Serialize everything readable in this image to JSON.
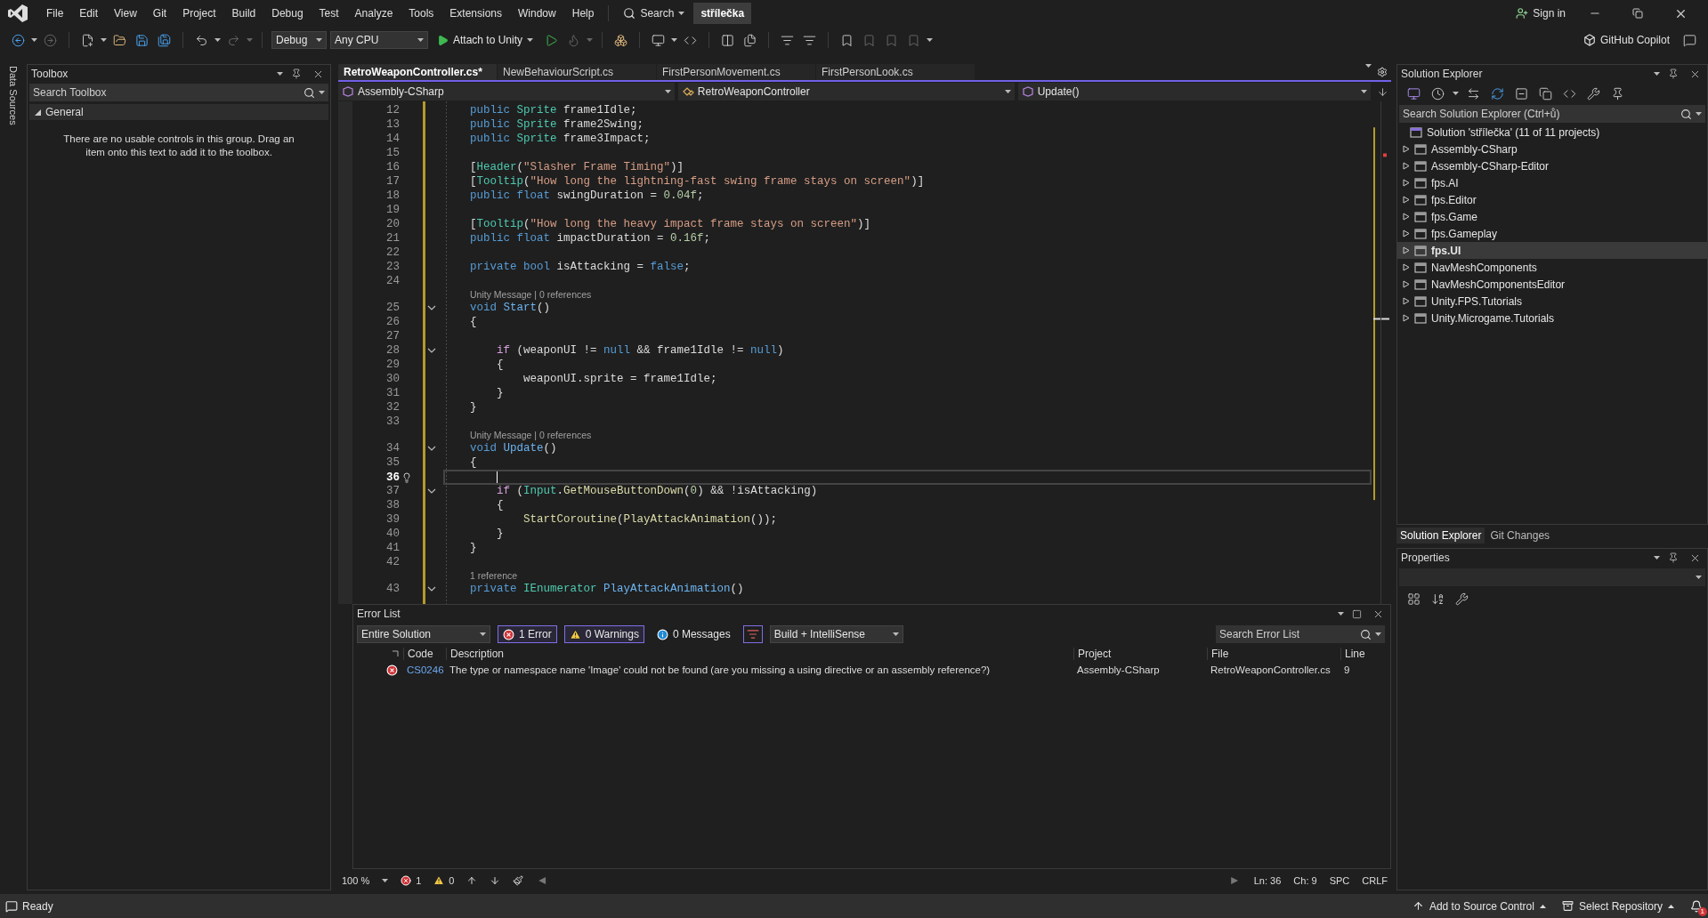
{
  "menu": {
    "items": [
      "File",
      "Edit",
      "View",
      "Git",
      "Project",
      "Build",
      "Debug",
      "Test",
      "Analyze",
      "Tools",
      "Extensions",
      "Window",
      "Help"
    ],
    "search": "Search",
    "solution": "střílečka",
    "sign_in": "Sign in"
  },
  "toolbar": {
    "configuration": "Debug",
    "platform": "Any CPU",
    "run": "Attach to Unity",
    "copilot": "GitHub Copilot"
  },
  "side_strip": {
    "label": "Data Sources"
  },
  "toolbox": {
    "title": "Toolbox",
    "search": {
      "placeholder": "Search Toolbox"
    },
    "group": {
      "label": "General",
      "expanded": true,
      "message": "There are no usable controls in this group. Drag an item onto this text to add it to the toolbox."
    }
  },
  "editor": {
    "tabs": [
      {
        "label": "RetroWeaponController.cs*",
        "selected": true
      },
      {
        "label": "NewBehaviourScript.cs",
        "selected": false
      },
      {
        "label": "FirstPersonMovement.cs",
        "selected": false
      },
      {
        "label": "FirstPersonLook.cs",
        "selected": false
      }
    ],
    "nav": [
      {
        "kind": "project",
        "label": "Assembly-CSharp"
      },
      {
        "kind": "class",
        "label": "RetroWeaponController"
      },
      {
        "kind": "method",
        "label": "Update()"
      }
    ],
    "lines": [
      {
        "kind": "code",
        "n": "12",
        "fold": false,
        "current": false,
        "tokens": [
          {
            "kind": "kw",
            "t": "public "
          },
          {
            "kind": "type",
            "t": "Sprite"
          },
          {
            "kind": "plain",
            "t": " frame1Idle;"
          }
        ]
      },
      {
        "kind": "code",
        "n": "13",
        "fold": false,
        "current": false,
        "tokens": [
          {
            "kind": "kw",
            "t": "public "
          },
          {
            "kind": "type",
            "t": "Sprite"
          },
          {
            "kind": "plain",
            "t": " frame2Swing;"
          }
        ]
      },
      {
        "kind": "code",
        "n": "14",
        "fold": false,
        "current": false,
        "tokens": [
          {
            "kind": "kw",
            "t": "public "
          },
          {
            "kind": "type",
            "t": "Sprite"
          },
          {
            "kind": "plain",
            "t": " frame3Impact;"
          }
        ]
      },
      {
        "kind": "code",
        "n": "15",
        "fold": false,
        "current": false
      },
      {
        "kind": "code",
        "n": "16",
        "fold": false,
        "current": false,
        "tokens": [
          {
            "kind": "plain",
            "t": "["
          },
          {
            "kind": "type",
            "t": "Header"
          },
          {
            "kind": "plain",
            "t": "("
          },
          {
            "kind": "str",
            "t": "\"Slasher Frame Timing\""
          },
          {
            "kind": "plain",
            "t": ")]"
          }
        ]
      },
      {
        "kind": "code",
        "n": "17",
        "fold": false,
        "current": false,
        "tokens": [
          {
            "kind": "plain",
            "t": "["
          },
          {
            "kind": "type",
            "t": "Tooltip"
          },
          {
            "kind": "plain",
            "t": "("
          },
          {
            "kind": "str",
            "t": "\"How long the lightning-fast swing frame stays on screen\""
          },
          {
            "kind": "plain",
            "t": ")]"
          }
        ]
      },
      {
        "kind": "code",
        "n": "18",
        "fold": false,
        "current": false,
        "tokens": [
          {
            "kind": "kw",
            "t": "public float"
          },
          {
            "kind": "plain",
            "t": " swingDuration = "
          },
          {
            "kind": "num",
            "t": "0.04f"
          },
          {
            "kind": "plain",
            "t": ";"
          }
        ]
      },
      {
        "kind": "code",
        "n": "19",
        "fold": false,
        "current": false
      },
      {
        "kind": "code",
        "n": "20",
        "fold": false,
        "current": false,
        "tokens": [
          {
            "kind": "plain",
            "t": "["
          },
          {
            "kind": "type",
            "t": "Tooltip"
          },
          {
            "kind": "plain",
            "t": "("
          },
          {
            "kind": "str",
            "t": "\"How long the heavy impact frame stays on screen\""
          },
          {
            "kind": "plain",
            "t": ")]"
          }
        ]
      },
      {
        "kind": "code",
        "n": "21",
        "fold": false,
        "current": false,
        "tokens": [
          {
            "kind": "kw",
            "t": "public float"
          },
          {
            "kind": "plain",
            "t": " impactDuration = "
          },
          {
            "kind": "num",
            "t": "0.16f"
          },
          {
            "kind": "plain",
            "t": ";"
          }
        ]
      },
      {
        "kind": "code",
        "n": "22",
        "fold": false,
        "current": false
      },
      {
        "kind": "code",
        "n": "23",
        "fold": false,
        "current": false,
        "tokens": [
          {
            "kind": "kw",
            "t": "private bool"
          },
          {
            "kind": "plain",
            "t": " isAttacking = "
          },
          {
            "kind": "kw",
            "t": "false"
          },
          {
            "kind": "plain",
            "t": ";"
          }
        ]
      },
      {
        "kind": "code",
        "n": "24",
        "fold": false,
        "current": false
      },
      {
        "kind": "lens",
        "text": "Unity Message | 0 references"
      },
      {
        "kind": "code",
        "n": "25",
        "fold": true,
        "current": false,
        "tokens": [
          {
            "kind": "kw",
            "t": "void "
          },
          {
            "kind": "fn",
            "t": "Start"
          },
          {
            "kind": "plain",
            "t": "()"
          }
        ]
      },
      {
        "kind": "code",
        "n": "26",
        "fold": false,
        "current": false,
        "tokens": [
          {
            "kind": "plain",
            "t": "{"
          }
        ]
      },
      {
        "kind": "code",
        "n": "27",
        "fold": false,
        "current": false
      },
      {
        "kind": "code",
        "n": "28",
        "fold": true,
        "current": false,
        "tokens": [
          {
            "kind": "ctrl",
            "t": "    if"
          },
          {
            "kind": "plain",
            "t": " (weaponUI != "
          },
          {
            "kind": "kw",
            "t": "null"
          },
          {
            "kind": "plain",
            "t": " && frame1Idle != "
          },
          {
            "kind": "kw",
            "t": "null"
          },
          {
            "kind": "plain",
            "t": ")"
          }
        ]
      },
      {
        "kind": "code",
        "n": "29",
        "fold": false,
        "current": false,
        "tokens": [
          {
            "kind": "plain",
            "t": "    {"
          }
        ]
      },
      {
        "kind": "code",
        "n": "30",
        "fold": false,
        "current": false,
        "tokens": [
          {
            "kind": "plain",
            "t": "        weaponUI.sprite = frame1Idle;"
          }
        ]
      },
      {
        "kind": "code",
        "n": "31",
        "fold": false,
        "current": false,
        "tokens": [
          {
            "kind": "plain",
            "t": "    }"
          }
        ]
      },
      {
        "kind": "code",
        "n": "32",
        "fold": false,
        "current": false,
        "tokens": [
          {
            "kind": "plain",
            "t": "}"
          }
        ]
      },
      {
        "kind": "code",
        "n": "33",
        "fold": false,
        "current": false
      },
      {
        "kind": "lens",
        "text": "Unity Message | 0 references"
      },
      {
        "kind": "code",
        "n": "34",
        "fold": true,
        "current": false,
        "tokens": [
          {
            "kind": "kw",
            "t": "void "
          },
          {
            "kind": "fn",
            "t": "Update"
          },
          {
            "kind": "plain",
            "t": "()"
          }
        ]
      },
      {
        "kind": "code",
        "n": "35",
        "fold": false,
        "current": false,
        "tokens": [
          {
            "kind": "plain",
            "t": "{"
          }
        ]
      },
      {
        "kind": "code",
        "n": "36",
        "fold": false,
        "current": true
      },
      {
        "kind": "code",
        "n": "37",
        "fold": true,
        "current": false,
        "tokens": [
          {
            "kind": "ctrl",
            "t": "    if"
          },
          {
            "kind": "plain",
            "t": " ("
          },
          {
            "kind": "type",
            "t": "Input"
          },
          {
            "kind": "plain",
            "t": "."
          },
          {
            "kind": "method",
            "t": "GetMouseButtonDown"
          },
          {
            "kind": "plain",
            "t": "("
          },
          {
            "kind": "num",
            "t": "0"
          },
          {
            "kind": "plain",
            "t": ") && !isAttacking)"
          }
        ]
      },
      {
        "kind": "code",
        "n": "38",
        "fold": false,
        "current": false,
        "tokens": [
          {
            "kind": "plain",
            "t": "    {"
          }
        ]
      },
      {
        "kind": "code",
        "n": "39",
        "fold": false,
        "current": false,
        "tokens": [
          {
            "kind": "method",
            "t": "        StartCoroutine"
          },
          {
            "kind": "plain",
            "t": "("
          },
          {
            "kind": "method",
            "t": "PlayAttackAnimation"
          },
          {
            "kind": "plain",
            "t": "());"
          }
        ]
      },
      {
        "kind": "code",
        "n": "40",
        "fold": false,
        "current": false,
        "tokens": [
          {
            "kind": "plain",
            "t": "    }"
          }
        ]
      },
      {
        "kind": "code",
        "n": "41",
        "fold": false,
        "current": false,
        "tokens": [
          {
            "kind": "plain",
            "t": "}"
          }
        ]
      },
      {
        "kind": "code",
        "n": "42",
        "fold": false,
        "current": false
      },
      {
        "kind": "lens",
        "text": "1 reference"
      },
      {
        "kind": "code",
        "n": "43",
        "fold": true,
        "current": false,
        "tokens": [
          {
            "kind": "kw",
            "t": "private "
          },
          {
            "kind": "type",
            "t": "IEnumerator"
          },
          {
            "kind": "fn",
            "t": " PlayAttackAnimation"
          },
          {
            "kind": "plain",
            "t": "()"
          }
        ]
      }
    ]
  },
  "error_list": {
    "title": "Error List",
    "scope": "Entire Solution",
    "toggles": [
      {
        "kind": "error",
        "label": "1 Error",
        "on": true
      },
      {
        "kind": "warning",
        "label": "0 Warnings",
        "on": true
      },
      {
        "kind": "info",
        "label": "0 Messages",
        "on": false
      }
    ],
    "filter_button": {
      "on": true
    },
    "source": "Build + IntelliSense",
    "search": {
      "placeholder": "Search Error List"
    },
    "columns": [
      "Code",
      "Description",
      "Project",
      "File",
      "Line"
    ],
    "rows": [
      {
        "kind": "error",
        "code": "CS0246",
        "description": "The type or namespace name 'Image' could not be found (are you missing a using directive or an assembly reference?)",
        "project": "Assembly-CSharp",
        "file": "RetroWeaponController.cs",
        "line": "9"
      }
    ]
  },
  "status_row": {
    "zoom": "100 %",
    "errors": "1",
    "warnings": "0",
    "line": "Ln: 36",
    "column": "Ch: 9",
    "whitespace": "SPC",
    "line_endings": "CRLF"
  },
  "solution_explorer": {
    "title": "Solution Explorer",
    "search": {
      "placeholder": "Search Solution Explorer (Ctrl+ů)"
    },
    "tree": [
      {
        "kind": "solution",
        "label": "Solution 'střílečka' (11 of 11 projects)",
        "selected": false,
        "children": [
          {
            "kind": "project",
            "label": "Assembly-CSharp",
            "expanded": false,
            "selected": false
          },
          {
            "kind": "project",
            "label": "Assembly-CSharp-Editor",
            "expanded": false,
            "selected": false
          },
          {
            "kind": "project",
            "label": "fps.AI",
            "expanded": false,
            "selected": false
          },
          {
            "kind": "project",
            "label": "fps.Editor",
            "expanded": false,
            "selected": false
          },
          {
            "kind": "project",
            "label": "fps.Game",
            "expanded": false,
            "selected": false
          },
          {
            "kind": "project",
            "label": "fps.Gameplay",
            "expanded": false,
            "selected": false
          },
          {
            "kind": "project",
            "label": "fps.UI",
            "expanded": false,
            "selected": true
          },
          {
            "kind": "project",
            "label": "NavMeshComponents",
            "expanded": false,
            "selected": false
          },
          {
            "kind": "project",
            "label": "NavMeshComponentsEditor",
            "expanded": false,
            "selected": false
          },
          {
            "kind": "project",
            "label": "Unity.FPS.Tutorials",
            "expanded": false,
            "selected": false
          },
          {
            "kind": "project",
            "label": "Unity.Microgame.Tutorials",
            "expanded": false,
            "selected": false
          }
        ]
      }
    ],
    "tabs": [
      {
        "label": "Solution Explorer",
        "selected": true
      },
      {
        "label": "Git Changes",
        "selected": false
      }
    ]
  },
  "properties": {
    "title": "Properties"
  },
  "status_bar": {
    "state": "Ready",
    "source_control": "Add to Source Control",
    "repository": "Select Repository",
    "notifications": "1"
  }
}
